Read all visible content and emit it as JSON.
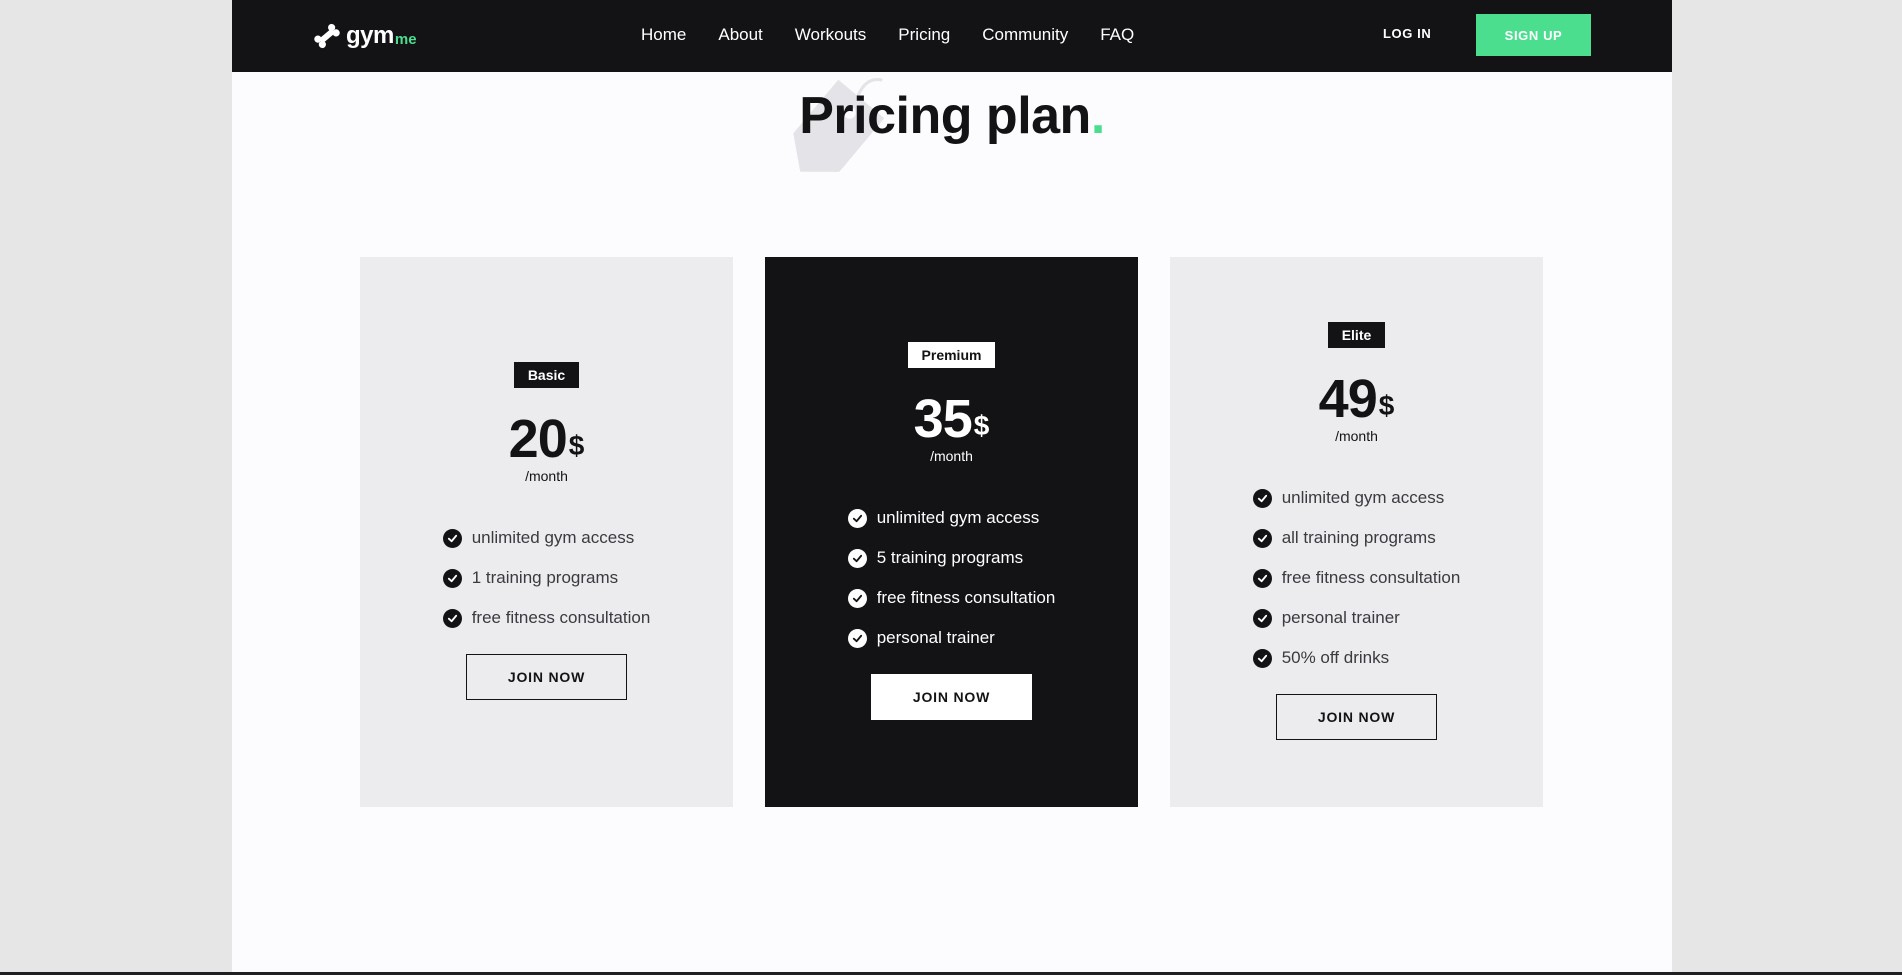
{
  "header": {
    "logo": {
      "main": "gym",
      "accent": "me"
    },
    "nav": [
      "Home",
      "About",
      "Workouts",
      "Pricing",
      "Community",
      "FAQ"
    ],
    "login_label": "LOG IN",
    "signup_label": "SIGN UP"
  },
  "title": {
    "text": "Pricing plan",
    "dot": "."
  },
  "colors": {
    "accent": "#4bde8f",
    "dark": "#131316",
    "card_light": "#ececef",
    "page_bg": "#fcfcfe"
  },
  "icons": {
    "logo": "bone-logo-icon",
    "title_bg": "price-tag-icon",
    "feature": "check-circle-icon"
  },
  "plans": [
    {
      "name": "Basic",
      "price": "20",
      "currency": "$",
      "period": "/month",
      "features": [
        "unlimited gym access",
        "1 training programs",
        "free fitness consultation"
      ],
      "button": "JOIN NOW"
    },
    {
      "name": "Premium",
      "price": "35",
      "currency": "$",
      "period": "/month",
      "features": [
        "unlimited gym access",
        "5 training programs",
        "free fitness consultation",
        "personal trainer"
      ],
      "button": "JOIN NOW"
    },
    {
      "name": "Elite",
      "price": "49",
      "currency": "$",
      "period": "/month",
      "features": [
        "unlimited gym access",
        "all training programs",
        "free fitness consultation",
        "personal trainer",
        "50% off drinks"
      ],
      "button": "JOIN NOW"
    }
  ]
}
